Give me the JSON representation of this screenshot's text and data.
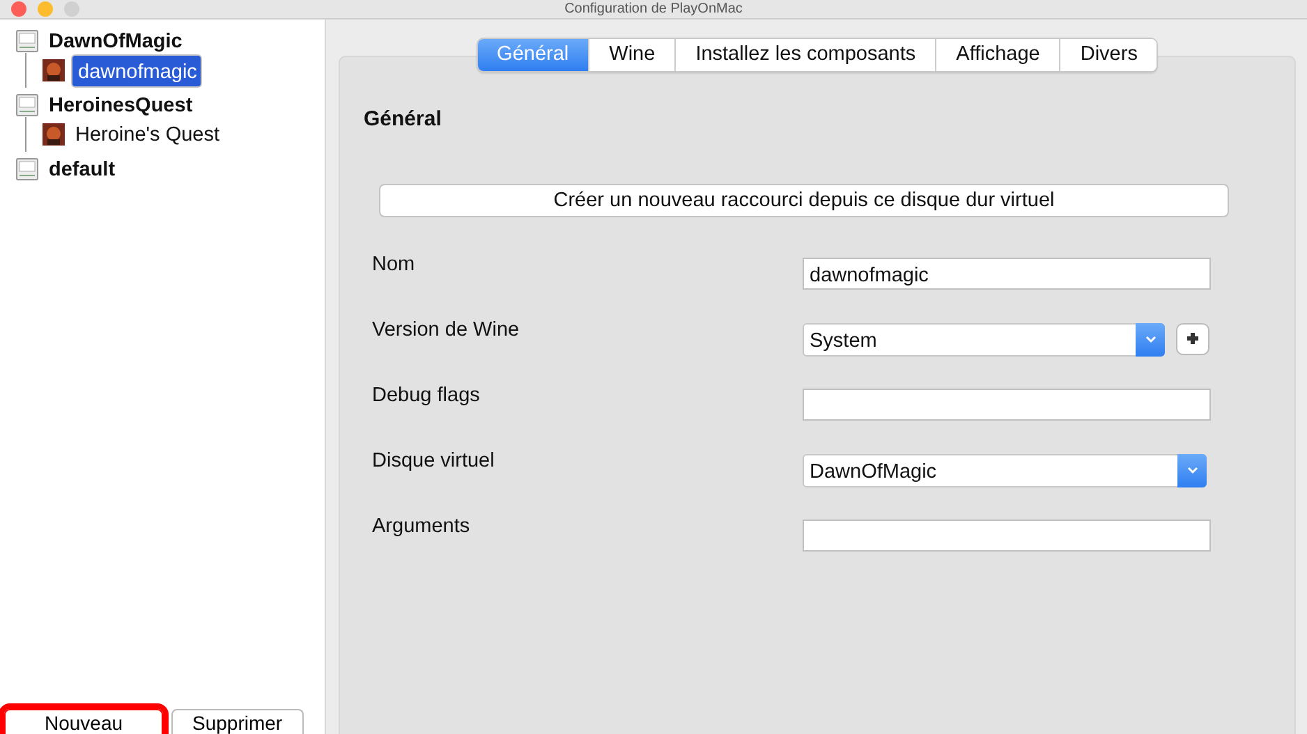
{
  "window": {
    "title": "Configuration de PlayOnMac"
  },
  "sidebar": {
    "tree": [
      {
        "label": "DawnOfMagic",
        "kind": "prefix",
        "selected": false,
        "children": [
          {
            "label": "dawnofmagic",
            "kind": "shortcut",
            "selected": true
          }
        ]
      },
      {
        "label": "HeroinesQuest",
        "kind": "prefix",
        "selected": false,
        "children": [
          {
            "label": "Heroine's Quest",
            "kind": "shortcut",
            "selected": false
          }
        ]
      },
      {
        "label": "default",
        "kind": "prefix",
        "selected": false
      }
    ],
    "buttons": [
      {
        "label": "Nouveau",
        "highlighted": true
      },
      {
        "label": "Supprimer",
        "highlighted": false
      }
    ]
  },
  "tabs": [
    {
      "label": "Général",
      "selected": true
    },
    {
      "label": "Wine",
      "selected": false
    },
    {
      "label": "Installez les composants",
      "selected": false
    },
    {
      "label": "Affichage",
      "selected": false
    },
    {
      "label": "Divers",
      "selected": false
    }
  ],
  "panel": {
    "heading": "Général",
    "shortcut_button": "Créer un nouveau raccourci depuis ce disque dur virtuel",
    "fields": [
      {
        "label": "Nom",
        "kind": "text",
        "value": "dawnofmagic"
      },
      {
        "label": "Version de Wine",
        "kind": "select-add",
        "value": "System"
      },
      {
        "label": "Debug flags",
        "kind": "text"
      },
      {
        "label": "Disque virtuel",
        "kind": "select",
        "value": "DawnOfMagic"
      },
      {
        "label": "Arguments",
        "kind": "text"
      }
    ]
  }
}
